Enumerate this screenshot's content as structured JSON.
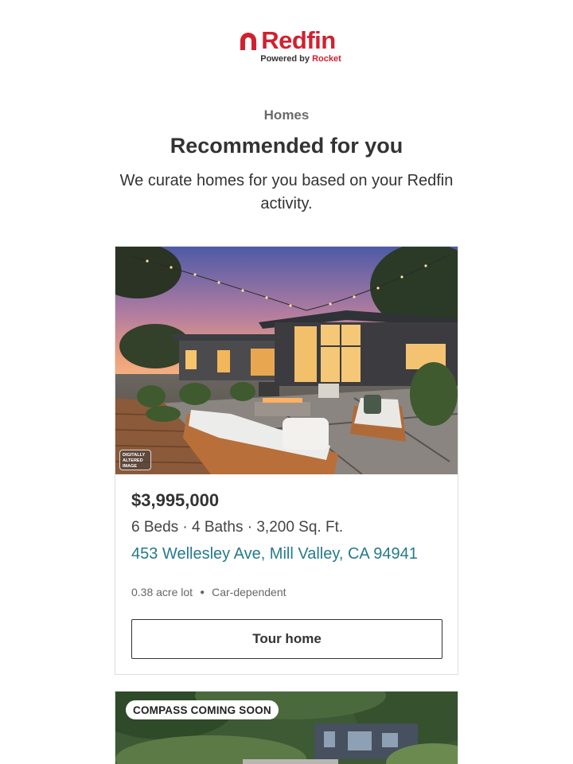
{
  "brand": {
    "name": "Redfin",
    "tagline_prefix": "Powered by",
    "tagline_partner": "Rocket",
    "color": "#d22030"
  },
  "section": {
    "eyebrow": "Homes",
    "title": "Recommended for you",
    "intro": "We curate homes for you based on your Redfin activity."
  },
  "listings": [
    {
      "photo_badge": "DIGITALLY ALTERED IMAGE",
      "price": "$3,995,000",
      "specs": "6 Beds · 4 Baths · 3,200 Sq. Ft.",
      "address": "453 Wellesley Ave, Mill Valley, CA 94941",
      "lot": "0.38 acre lot",
      "walkability": "Car-dependent",
      "cta": "Tour home"
    },
    {
      "photo_badge": "COMPASS COMING SOON"
    }
  ],
  "colors": {
    "link": "#257a8c",
    "text": "#333333"
  }
}
